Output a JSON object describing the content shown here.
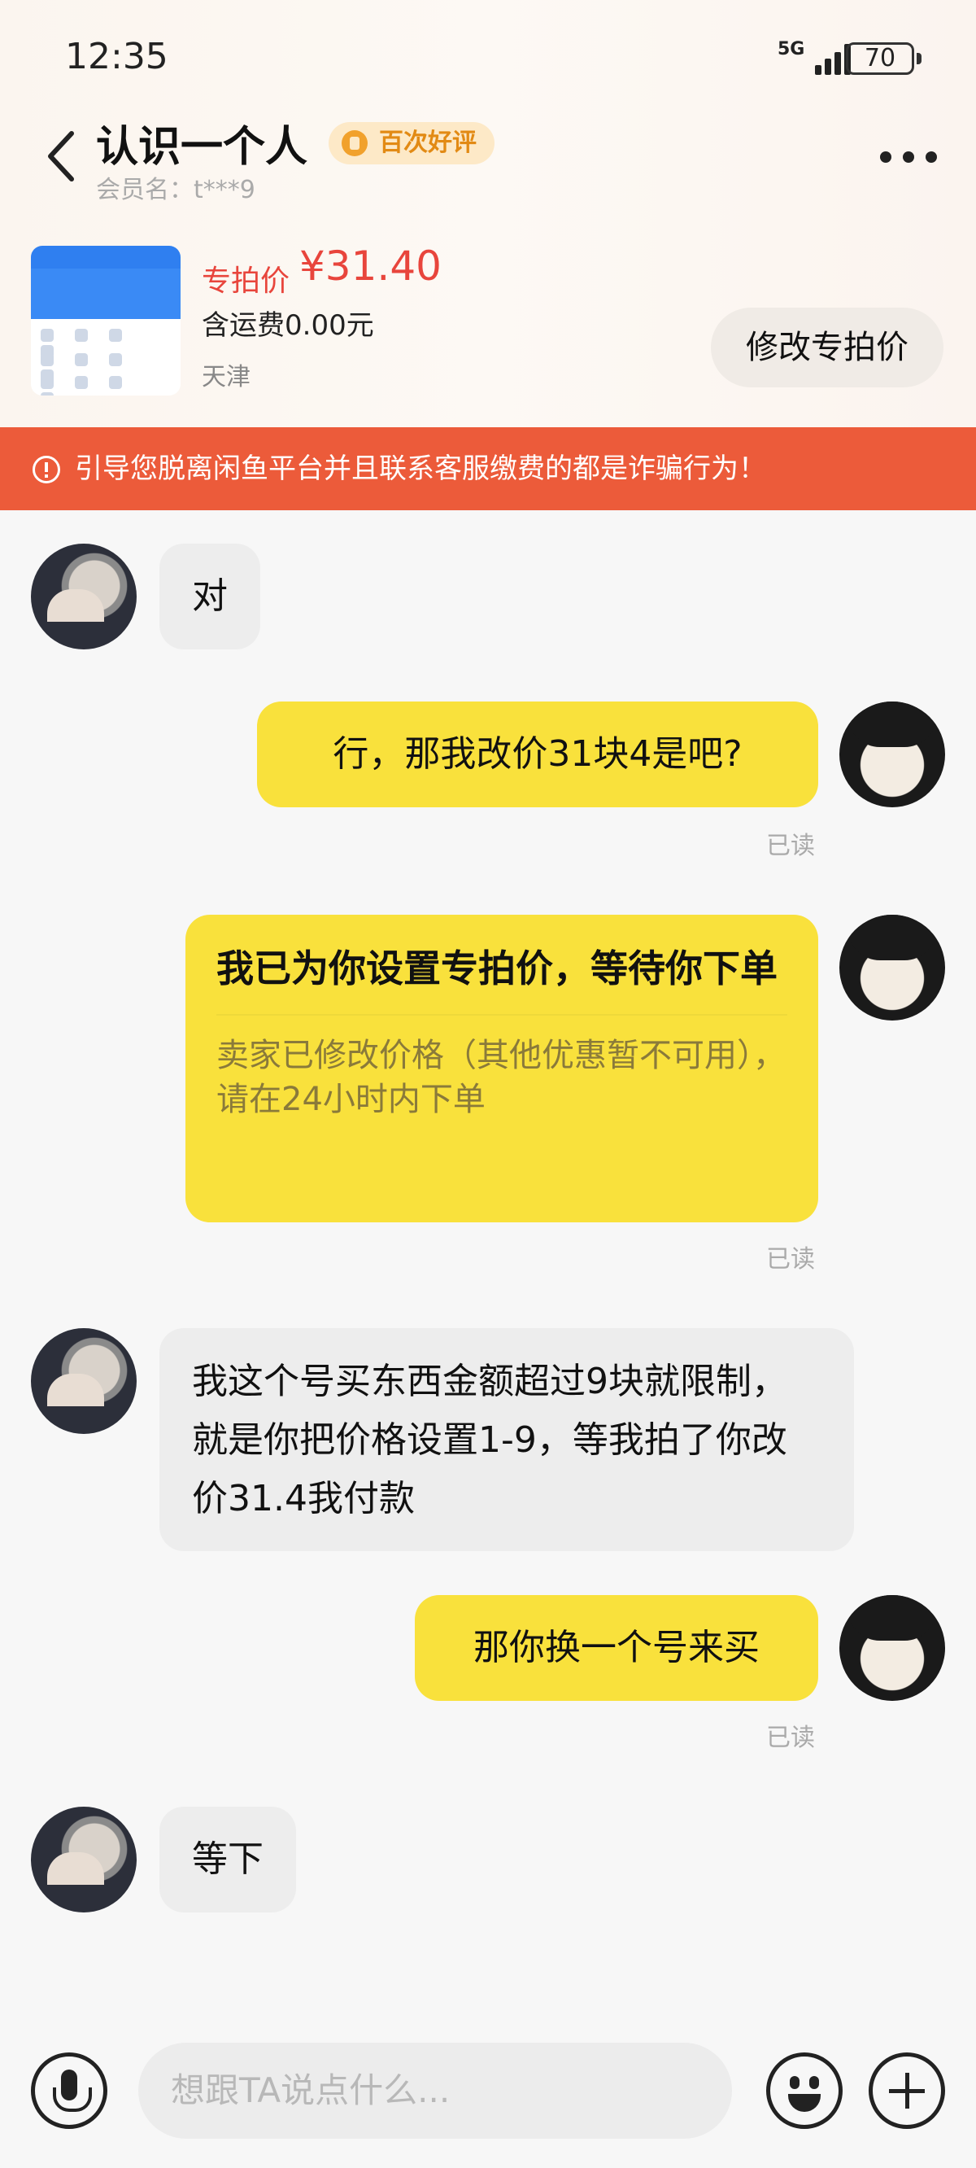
{
  "status_bar": {
    "time": "12:35",
    "network": "5G",
    "battery": "70"
  },
  "header": {
    "title": "认识一个人",
    "badge": "百次好评",
    "member": "会员名：t***9"
  },
  "product": {
    "price_label": "专拍价",
    "price": "¥31.40",
    "shipping": "含运费0.00元",
    "location": "天津",
    "modify_button": "修改专拍价"
  },
  "warning": "引导您脱离闲鱼平台并且联系客服缴费的都是诈骗行为！",
  "messages": [
    {
      "side": "left",
      "text": "对"
    },
    {
      "side": "right",
      "text": "行，那我改价31块4是吧?",
      "status": "已读"
    },
    {
      "side": "right",
      "card_title": "我已为你设置专拍价，等待你下单",
      "card_sub": "卖家已修改价格（其他优惠暂不可用），请在24小时内下单",
      "status": "已读"
    },
    {
      "side": "left",
      "text": "我这个号买东西金额超过9块就限制，就是你把价格设置1-9，等我拍了你改价31.4我付款"
    },
    {
      "side": "right",
      "text": "那你换一个号来买",
      "status": "已读"
    },
    {
      "side": "left",
      "text": "等下"
    }
  ],
  "input": {
    "placeholder": "想跟TA说点什么..."
  },
  "icons": {
    "back": "back-arrow-icon",
    "more": "more-dots-icon",
    "mic": "microphone-icon",
    "emoji": "emoji-icon",
    "add": "plus-icon",
    "warning": "warning-icon",
    "badge": "thumbs-up-icon"
  },
  "colors": {
    "accent_yellow": "#f9e13c",
    "price_red": "#e8453c",
    "warning_bg": "#ec5b3a"
  }
}
